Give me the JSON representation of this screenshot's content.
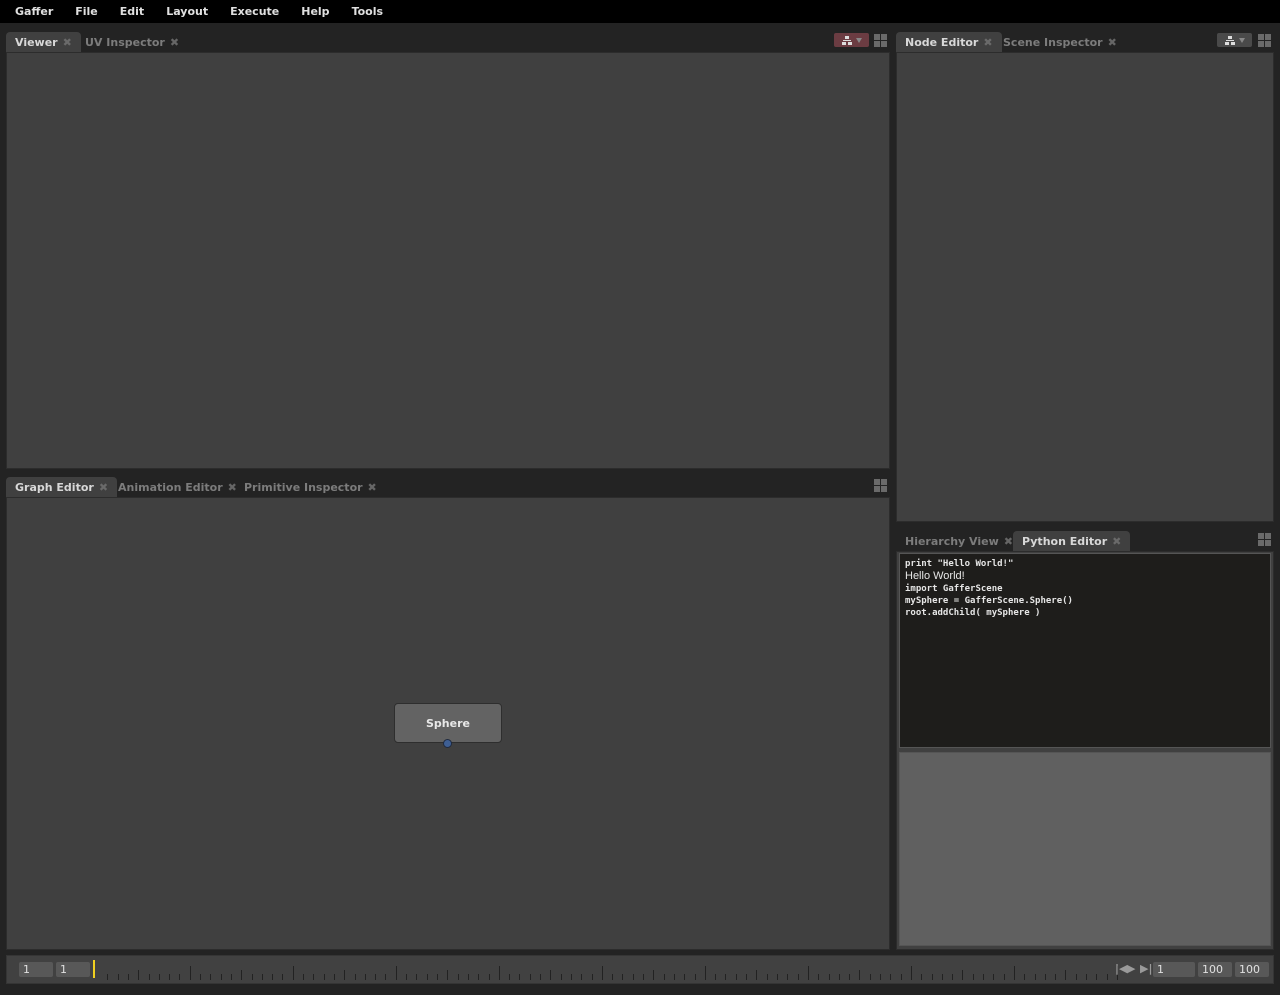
{
  "menubar": {
    "items": [
      "Gaffer",
      "File",
      "Edit",
      "Layout",
      "Execute",
      "Help",
      "Tools"
    ]
  },
  "viewer_panel": {
    "tabs": [
      {
        "label": "Viewer",
        "active": true
      },
      {
        "label": "UV Inspector",
        "active": false
      }
    ],
    "close_glyph": "✖",
    "filter_color": "#6b3c42"
  },
  "node_panel": {
    "tabs": [
      {
        "label": "Node Editor",
        "active": true
      },
      {
        "label": "Scene Inspector",
        "active": false
      }
    ],
    "close_glyph": "✖"
  },
  "graph_panel": {
    "tabs": [
      {
        "label": "Graph Editor",
        "active": true
      },
      {
        "label": "Animation Editor",
        "active": false
      },
      {
        "label": "Primitive Inspector",
        "active": false
      }
    ],
    "close_glyph": "✖",
    "nodes": [
      {
        "name": "Sphere",
        "plug_color": "#3e5f94"
      }
    ]
  },
  "python_panel": {
    "tabs": [
      {
        "label": "Hierarchy View",
        "active": false
      },
      {
        "label": "Python Editor",
        "active": true
      }
    ],
    "close_glyph": "✖",
    "output": [
      {
        "type": "code",
        "text": "print \"Hello World!\""
      },
      {
        "type": "result",
        "text": "Hello World!"
      },
      {
        "type": "code",
        "text": "import GafferScene"
      },
      {
        "type": "code",
        "text": "mySphere = GafferScene.Sphere()"
      },
      {
        "type": "code",
        "text": "root.addChild( mySphere )"
      }
    ],
    "input": ""
  },
  "timeline": {
    "start_frame": "1",
    "range_start": "1",
    "current_frame": "1",
    "range_end": "100",
    "end_frame": "100",
    "cursor_color": "#f0d020",
    "transport": {
      "prev_icon": "⏮",
      "play_icon": "▶",
      "next_icon": "⏭"
    }
  }
}
